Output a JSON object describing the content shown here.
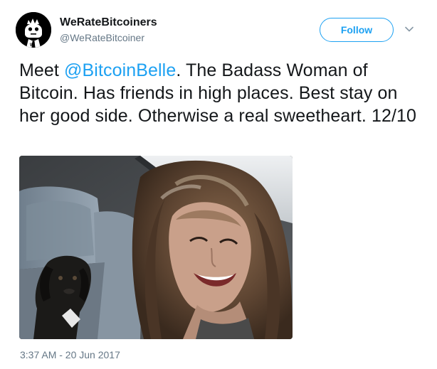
{
  "account": {
    "display_name": "WeRateBitcoiners",
    "handle": "@WeRateBitcoiner",
    "avatar_icon": "robot-avatar-icon"
  },
  "follow_button": {
    "label": "Follow"
  },
  "menu": {
    "icon": "chevron-down-icon"
  },
  "tweet": {
    "text_before": "Meet ",
    "mention": "@BitcoinBelle",
    "text_after": ". The Badass Woman of Bitcoin. Has friends in high places. Best stay on her good side. Otherwise a real sweetheart. 12/10",
    "timestamp": "3:37 AM - 20 Jun 2017"
  },
  "colors": {
    "accent": "#1da1f2",
    "text": "#14171a",
    "secondary": "#657786"
  }
}
